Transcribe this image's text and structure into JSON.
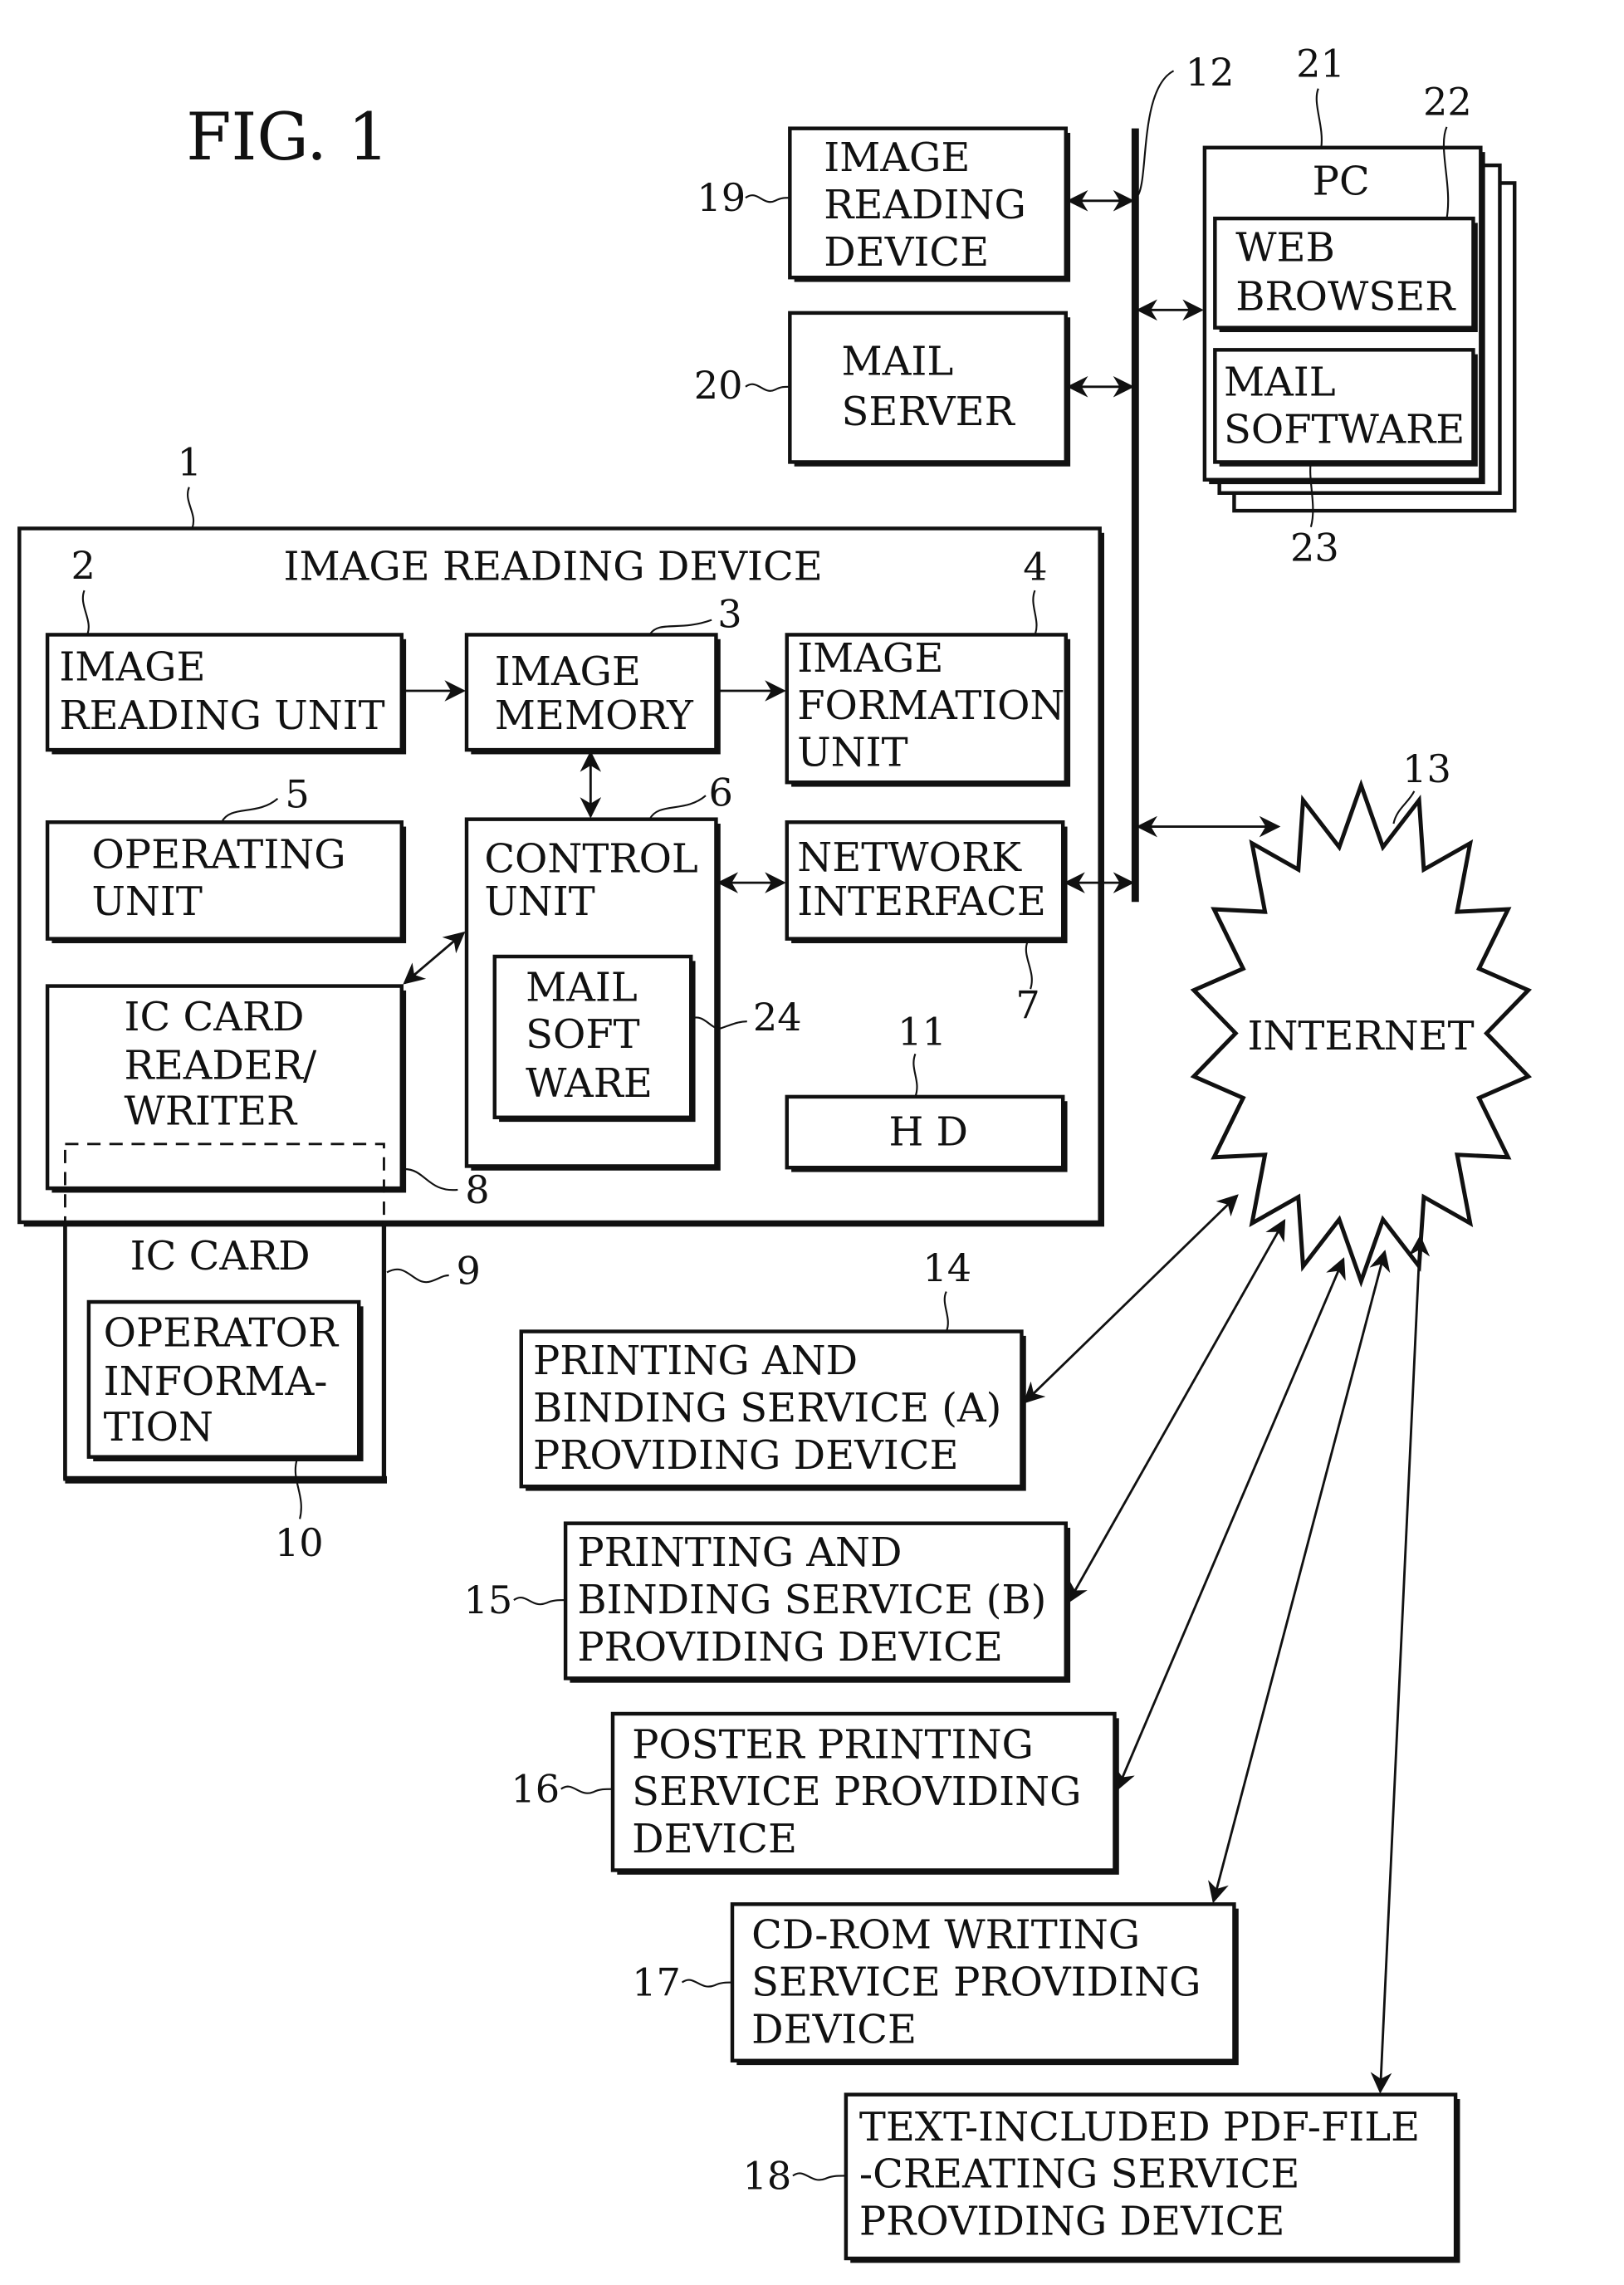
{
  "figure": {
    "title": "FIG. 1"
  },
  "labels": {
    "device_1": {
      "ref": "1",
      "title": "IMAGE READING DEVICE"
    },
    "image_reading_unit": {
      "ref": "2",
      "lines": [
        "IMAGE",
        "READING UNIT"
      ]
    },
    "image_memory": {
      "ref": "3",
      "lines": [
        "IMAGE",
        "MEMORY"
      ]
    },
    "image_formation_unit": {
      "ref": "4",
      "lines": [
        "IMAGE",
        "FORMATION",
        "UNIT"
      ]
    },
    "operating_unit": {
      "ref": "5",
      "lines": [
        "OPERATING",
        "UNIT"
      ]
    },
    "control_unit": {
      "ref": "6",
      "lines": [
        "CONTROL",
        "UNIT"
      ]
    },
    "network_interface": {
      "ref": "7",
      "lines": [
        "NETWORK",
        "INTERFACE"
      ]
    },
    "ic_card_rw": {
      "ref": "8",
      "lines": [
        "IC CARD",
        "READER/",
        "WRITER"
      ]
    },
    "ic_card": {
      "ref": "9",
      "lines": [
        "IC CARD"
      ]
    },
    "operator_info": {
      "ref": "10",
      "lines": [
        "OPERATOR",
        "INFORMA-",
        "TION"
      ]
    },
    "hd": {
      "ref": "11",
      "lines": [
        "H D"
      ]
    },
    "bus": {
      "ref": "12"
    },
    "internet": {
      "ref": "13",
      "lines": [
        "INTERNET"
      ]
    },
    "service_14": {
      "ref": "14",
      "lines": [
        "PRINTING AND",
        "BINDING SERVICE (A)",
        "PROVIDING DEVICE"
      ]
    },
    "service_15": {
      "ref": "15",
      "lines": [
        "PRINTING AND",
        "BINDING SERVICE (B)",
        "PROVIDING DEVICE"
      ]
    },
    "service_16": {
      "ref": "16",
      "lines": [
        "POSTER PRINTING",
        "SERVICE PROVIDING",
        "DEVICE"
      ]
    },
    "service_17": {
      "ref": "17",
      "lines": [
        "CD-ROM WRITING",
        "SERVICE PROVIDING",
        "DEVICE"
      ]
    },
    "service_18": {
      "ref": "18",
      "lines": [
        "TEXT-INCLUDED PDF-FILE",
        "-CREATING SERVICE",
        "PROVIDING DEVICE"
      ]
    },
    "device_19": {
      "ref": "19",
      "lines": [
        "IMAGE",
        "READING",
        "DEVICE"
      ]
    },
    "mail_server": {
      "ref": "20",
      "lines": [
        "MAIL",
        "SERVER"
      ]
    },
    "pc": {
      "ref": "21",
      "lines": [
        "PC"
      ]
    },
    "web_browser": {
      "ref": "22",
      "lines": [
        "WEB",
        "BROWSER"
      ]
    },
    "pc_mail_software": {
      "ref": "23",
      "lines": [
        "MAIL",
        "SOFTWARE"
      ]
    },
    "mail_soft_ware": {
      "ref": "24",
      "lines": [
        "MAIL",
        "SOFT",
        "WARE"
      ]
    }
  }
}
